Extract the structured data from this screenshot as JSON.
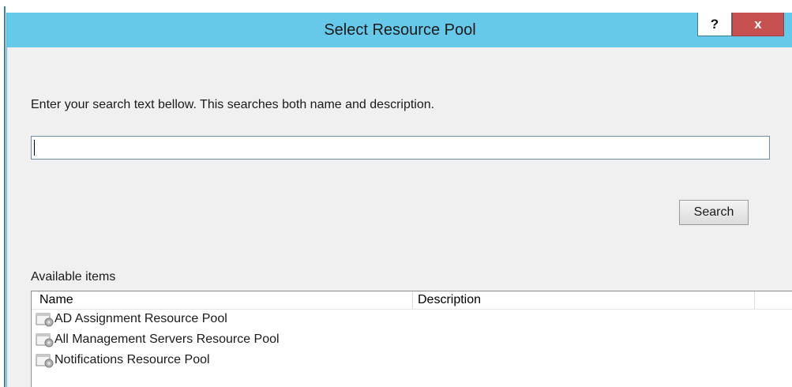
{
  "window": {
    "title": "Select Resource Pool",
    "help_label": "?",
    "close_label": "x"
  },
  "search": {
    "instruction": "Enter your search text bellow. This searches both name and description.",
    "value": "",
    "button_label": "Search"
  },
  "list": {
    "label": "Available items",
    "columns": {
      "name": "Name",
      "description": "Description"
    },
    "items": [
      {
        "name": "AD Assignment Resource Pool",
        "description": "",
        "icon": "resource-pool-icon"
      },
      {
        "name": "All Management Servers Resource Pool",
        "description": "",
        "icon": "resource-pool-icon"
      },
      {
        "name": "Notifications Resource Pool",
        "description": "",
        "icon": "resource-pool-icon"
      }
    ]
  },
  "colors": {
    "titlebar": "#66c9ea",
    "close_button": "#c75050",
    "dialog_background": "#f0f0f0"
  }
}
